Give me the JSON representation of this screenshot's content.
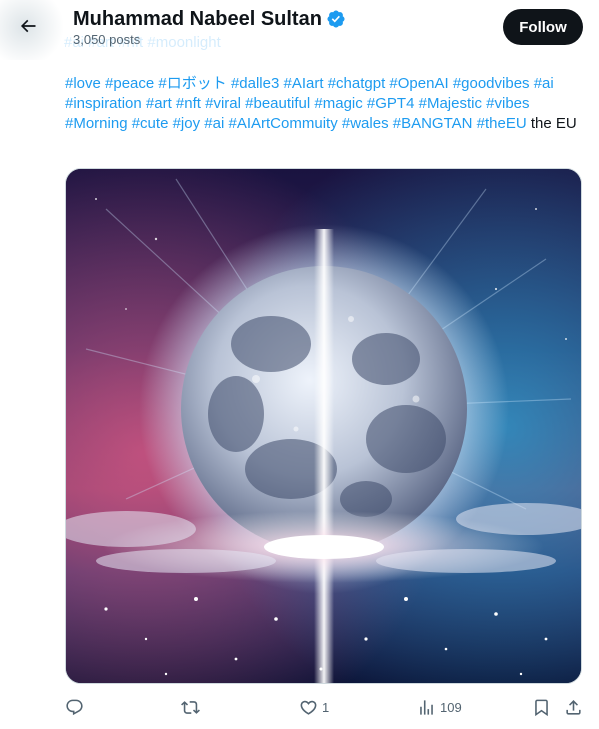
{
  "header": {
    "title": "Muhammad Nabeel Sultan",
    "posts_count": "3,050 posts",
    "follow_label": "Follow",
    "background_text": "#ai #art #nft #moonlight"
  },
  "tweet": {
    "hashtags": [
      "#love",
      "#peace",
      "#ロボット",
      "#dalle3",
      "#AIart",
      "#chatgpt",
      "#OpenAI",
      "#goodvibes",
      "#ai",
      "#inspiration",
      "#art",
      "#nft",
      "#viral",
      "#beautiful",
      "#magic",
      "#GPT4",
      "#Majestic",
      "#vibes",
      "#Morning",
      "#cute",
      "#joy",
      "#ai",
      "#AIArtCommuity",
      "#wales",
      "#BANGTAN",
      "#theEU"
    ],
    "trailing_text": " the EU",
    "media_description_icon": "moon-art-image"
  },
  "actions": {
    "reply_count": "",
    "repost_count": "",
    "like_count": "1",
    "views_count": "109"
  },
  "colors": {
    "accent": "#1d9bf0",
    "text_primary": "#0f1419",
    "text_secondary": "#536471",
    "follow_bg": "#0f1419"
  },
  "icons": {
    "back": "arrow-left-icon",
    "verified": "verified-badge-icon",
    "reply": "reply-icon",
    "repost": "repost-icon",
    "like": "heart-icon",
    "views": "views-chart-icon",
    "bookmark": "bookmark-icon",
    "share": "share-icon"
  }
}
